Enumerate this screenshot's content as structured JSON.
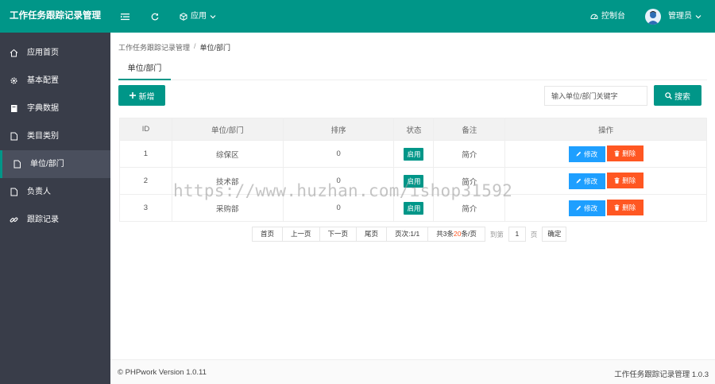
{
  "app": {
    "title": "工作任务跟踪记录管理"
  },
  "header": {
    "apps_label": "应用",
    "console_label": "控制台",
    "user_label": "管理员",
    "colors": {
      "primary": "#009688",
      "sidebar": "#393d49"
    },
    "icons": [
      "menu-toggle-icon",
      "refresh-icon",
      "cube-icon",
      "chevron-down-icon",
      "dashboard-icon",
      "user-avatar"
    ]
  },
  "sidebar": {
    "items": [
      {
        "label": "应用首页",
        "icon": "home-icon"
      },
      {
        "label": "基本配置",
        "icon": "gear-icon"
      },
      {
        "label": "字典数据",
        "icon": "book-icon"
      },
      {
        "label": "类目类别",
        "icon": "file-icon"
      },
      {
        "label": "单位/部门",
        "icon": "file-icon",
        "active": true
      },
      {
        "label": "负责人",
        "icon": "file-icon"
      },
      {
        "label": "跟踪记录",
        "icon": "link-icon"
      }
    ]
  },
  "breadcrumb": {
    "root": "工作任务跟踪记录管理",
    "separator": "/",
    "current": "单位/部门"
  },
  "tab": {
    "label": "单位/部门"
  },
  "toolbar": {
    "add_label": "新增",
    "search_placeholder": "输入单位/部门关键字",
    "search_label": "搜索"
  },
  "table": {
    "headers": [
      "ID",
      "单位/部门",
      "排序",
      "状态",
      "备注",
      "操作"
    ],
    "rows": [
      {
        "id": "1",
        "name": "综保区",
        "sort": "0",
        "status": "启用",
        "note": "简介"
      },
      {
        "id": "2",
        "name": "技术部",
        "sort": "0",
        "status": "启用",
        "note": "简介"
      },
      {
        "id": "3",
        "name": "采购部",
        "sort": "0",
        "status": "启用",
        "note": "简介"
      }
    ],
    "edit_label": "修改",
    "delete_label": "删除"
  },
  "pager": {
    "first": "首页",
    "prev": "上一页",
    "next": "下一页",
    "last": "尾页",
    "page_info": "页次:1/1",
    "total_prefix": "共3条",
    "per_page": "20",
    "per_page_suffix": "条/页",
    "goto_label": "到第",
    "goto_value": "1",
    "page_unit": "页",
    "confirm": "确定"
  },
  "footer": {
    "left": "© PHPwork Version 1.0.11",
    "right": "工作任务跟踪记录管理 1.0.3"
  },
  "watermark": "https://www.huzhan.com/ishop31592"
}
